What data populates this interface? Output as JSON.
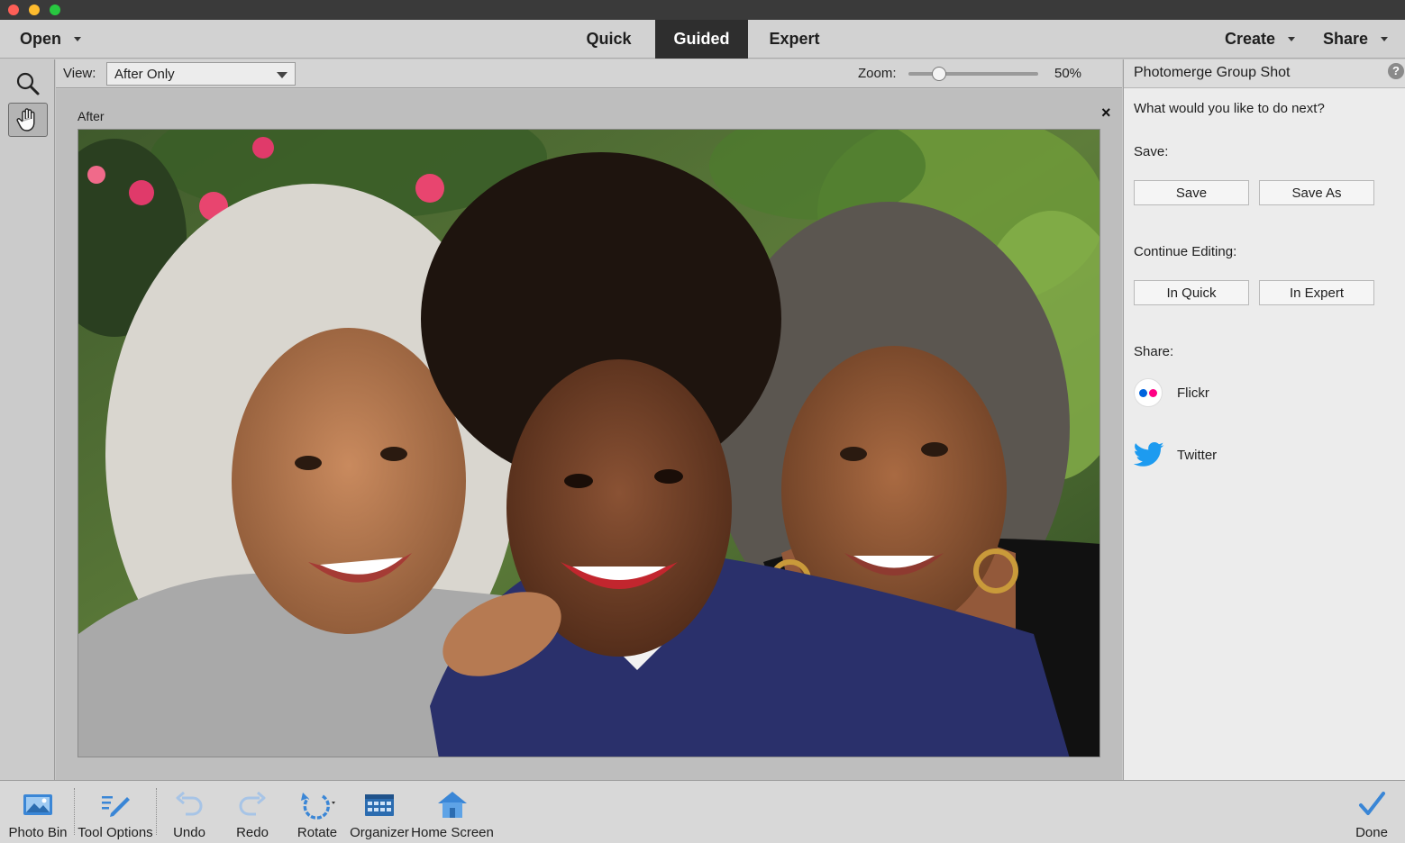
{
  "menu": {
    "open": "Open",
    "modes": [
      "Quick",
      "Guided",
      "Expert"
    ],
    "active_mode": "Guided",
    "create": "Create",
    "share": "Share"
  },
  "options": {
    "view_label": "View:",
    "view_value": "After Only",
    "zoom_label": "Zoom:",
    "zoom_value": "50%",
    "zoom_level": 0.2
  },
  "canvas": {
    "label": "After",
    "close_symbol": "×"
  },
  "panel": {
    "title": "Photomerge Group Shot",
    "prompt": "What would you like to do next?",
    "save_heading": "Save:",
    "save_button": "Save",
    "save_as_button": "Save As",
    "continue_heading": "Continue Editing:",
    "in_quick_button": "In Quick",
    "in_expert_button": "In Expert",
    "share_heading": "Share:",
    "flickr": "Flickr",
    "twitter": "Twitter",
    "help": "?"
  },
  "bottom": {
    "photo_bin": "Photo Bin",
    "tool_options": "Tool Options",
    "undo": "Undo",
    "redo": "Redo",
    "rotate": "Rotate",
    "organizer": "Organizer",
    "home_screen": "Home Screen",
    "done": "Done"
  },
  "colors": {
    "accent_blue": "#3a86d6",
    "twitter_blue": "#1d9bf0",
    "flickr_blue": "#0063dc",
    "flickr_pink": "#ff0084",
    "active_tab": "#2e2e2e"
  }
}
